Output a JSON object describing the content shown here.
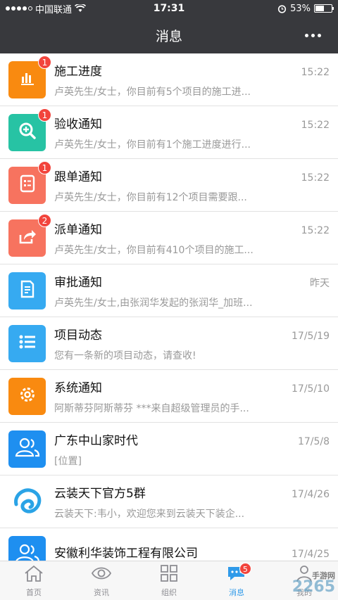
{
  "status_bar": {
    "carrier": "中国联通",
    "time": "17:31",
    "battery": "53%",
    "battery_level": 0.53
  },
  "header": {
    "title": "消息"
  },
  "messages": [
    {
      "title": "施工进度",
      "time": "15:22",
      "preview": "卢英先生/女士，你目前有5个项目的施工进...",
      "badge": "1",
      "icon": "bar-chart-icon",
      "color": "#f98a10"
    },
    {
      "title": "验收通知",
      "time": "15:22",
      "preview": "卢英先生/女士，你目前有1个施工进度进行...",
      "badge": "1",
      "icon": "search-plus-icon",
      "color": "#27c3a4"
    },
    {
      "title": "跟单通知",
      "time": "15:22",
      "preview": "卢英先生/女士，你目前有12个项目需要跟...",
      "badge": "1",
      "icon": "checklist-icon",
      "color": "#f7735f"
    },
    {
      "title": "派单通知",
      "time": "15:22",
      "preview": "卢英先生/女士，你目前有410个项目的施工...",
      "badge": "2",
      "icon": "share-icon",
      "color": "#f7735f"
    },
    {
      "title": "审批通知",
      "time": "昨天",
      "preview": "卢英先生/女士,由张润华发起的张润华_加班...",
      "badge": "",
      "icon": "document-icon",
      "color": "#36aaf1"
    },
    {
      "title": "项目动态",
      "time": "17/5/19",
      "preview": "您有一条新的项目动态，请查收!",
      "badge": "",
      "icon": "list-icon",
      "color": "#36aaf1"
    },
    {
      "title": "系统通知",
      "time": "17/5/10",
      "preview": "阿斯蒂芬阿斯蒂芬 ***来自超级管理员的手...",
      "badge": "",
      "icon": "gear-icon",
      "color": "#f98a10"
    },
    {
      "title": "广东中山家时代",
      "time": "17/5/8",
      "preview": "[位置]",
      "badge": "",
      "icon": "group-icon",
      "color": "#1e8ff0"
    },
    {
      "title": "云装天下官方5群",
      "time": "17/4/26",
      "preview": "云装天下:韦小，欢迎您来到云装天下装企...",
      "badge": "",
      "icon": "logo-icon",
      "color": "#ffffff"
    },
    {
      "title": "安徽利华装饰工程有限公司",
      "time": "17/4/25",
      "preview": "",
      "badge": "",
      "icon": "group-icon",
      "color": "#1e8ff0"
    }
  ],
  "tabs": [
    {
      "label": "首页",
      "icon": "home-icon",
      "active": false,
      "badge": ""
    },
    {
      "label": "资讯",
      "icon": "eye-icon",
      "active": false,
      "badge": ""
    },
    {
      "label": "组织",
      "icon": "grid-icon",
      "active": false,
      "badge": ""
    },
    {
      "label": "消息",
      "icon": "chat-icon",
      "active": true,
      "badge": "5"
    },
    {
      "label": "我的",
      "icon": "person-icon",
      "active": false,
      "badge": ""
    }
  ],
  "watermark": {
    "text": "2265",
    "subtext": "手游网"
  }
}
